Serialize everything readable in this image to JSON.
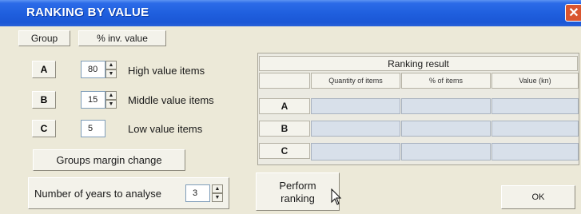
{
  "window": {
    "title": "RANKING BY VALUE",
    "close_label": "✕"
  },
  "headers": {
    "group": "Group",
    "inv_value": "% inv. value"
  },
  "groups": [
    {
      "letter": "A",
      "value": "80",
      "label": "High value items"
    },
    {
      "letter": "B",
      "value": "15",
      "label": "Middle value items"
    },
    {
      "letter": "C",
      "value": "5",
      "label": "Low value items"
    }
  ],
  "margin_button": "Groups margin change",
  "years": {
    "label": "Number of years to analyse",
    "value": "3"
  },
  "result": {
    "title": "Ranking result",
    "columns": [
      "Quantity of items",
      "% of items",
      "Value (kn)"
    ],
    "rows": [
      "A",
      "B",
      "C"
    ]
  },
  "perform_button": {
    "line1": "Perform",
    "line2": "ranking"
  },
  "ok_button": "OK"
}
